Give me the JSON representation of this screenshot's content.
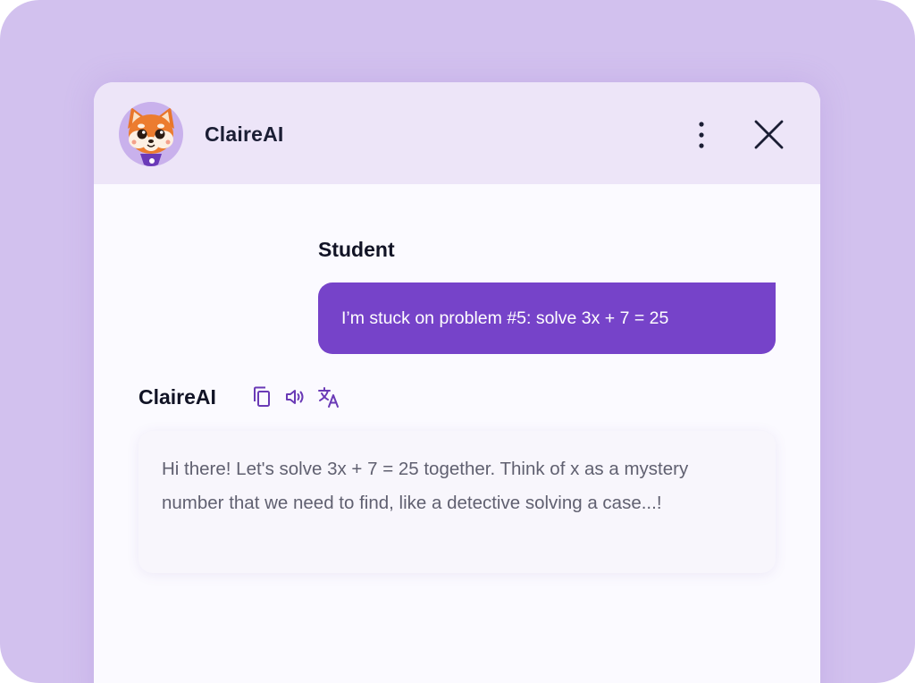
{
  "header": {
    "title": "ClaireAI",
    "avatar_icon": "red-panda-mascot-icon",
    "more_icon": "more-vertical-icon",
    "close_icon": "close-icon"
  },
  "conversation": {
    "student": {
      "name": "Student",
      "message": "I’m stuck on problem #5: solve 3x + 7 = 25"
    },
    "assistant": {
      "name": "ClaireAI",
      "actions": [
        {
          "icon": "copy-icon"
        },
        {
          "icon": "speaker-icon"
        },
        {
          "icon": "translate-icon"
        }
      ],
      "message": "Hi there! Let's solve 3x + 7 = 25 together. Think of x as a mystery number that we need to find, like a detective solving a case...!"
    }
  },
  "colors": {
    "backdrop": "#d2c1ee",
    "header": "#ede5f8",
    "accent": "#7643c9",
    "icon": "#6a3ab6",
    "text_dark": "#111325",
    "text_muted": "#606070"
  }
}
